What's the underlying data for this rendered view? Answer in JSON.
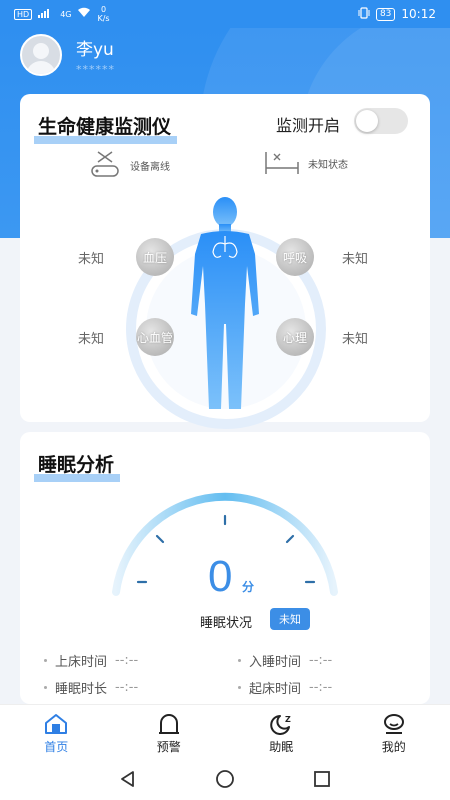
{
  "status_bar": {
    "sig_badge": "HD",
    "net_type": "4G",
    "net_speed_value": "0",
    "net_speed_unit": "K/s",
    "battery": "83",
    "time": "10:12"
  },
  "user": {
    "name": "李yu",
    "subtitle": "******"
  },
  "monitor": {
    "title": "生命健康监测仪",
    "toggle_label": "监测开启",
    "toggle_on": false,
    "device_status": "设备离线",
    "bed_status": "未知状态",
    "metrics": [
      {
        "label": "血压",
        "value": "未知"
      },
      {
        "label": "呼吸",
        "value": "未知"
      },
      {
        "label": "心血管",
        "value": "未知"
      },
      {
        "label": "心理",
        "value": "未知"
      }
    ]
  },
  "sleep": {
    "title": "睡眠分析",
    "score": "0",
    "score_unit": "分",
    "state_label": "睡眠状况",
    "state_value": "未知",
    "info": [
      {
        "label": "上床时间",
        "value": "--:--"
      },
      {
        "label": "入睡时间",
        "value": "--:--"
      },
      {
        "label": "睡眠时长",
        "value": "--:--"
      },
      {
        "label": "起床时间",
        "value": "--:--"
      }
    ]
  },
  "tabs": [
    {
      "label": "首页",
      "icon": "home-icon",
      "active": true
    },
    {
      "label": "预警",
      "icon": "alert-icon",
      "active": false
    },
    {
      "label": "助眠",
      "icon": "moon-icon",
      "active": false
    },
    {
      "label": "我的",
      "icon": "profile-icon",
      "active": false
    }
  ],
  "colors": {
    "primary": "#2f8ff0",
    "accent": "#3c8ee6",
    "tab_active": "#2f7fe4"
  }
}
